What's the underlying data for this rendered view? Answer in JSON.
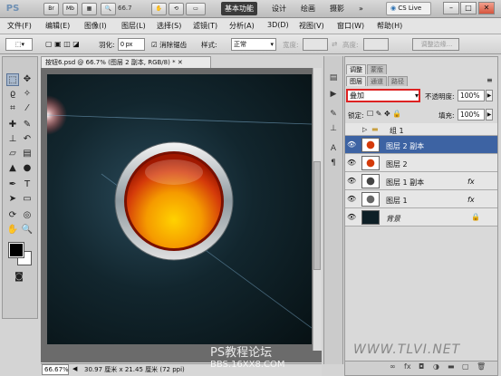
{
  "app": {
    "logo": "PS",
    "bridge": "Br",
    "minibridge": "Mb",
    "zoom": "66.7",
    "workspaces": [
      "基本功能",
      "设计",
      "绘画",
      "摄影"
    ],
    "more": "»",
    "cslive": "CS Live"
  },
  "menu": [
    "文件(F)",
    "编辑(E)",
    "图像(I)",
    "图层(L)",
    "选择(S)",
    "滤镜(T)",
    "分析(A)",
    "3D(D)",
    "视图(V)",
    "窗口(W)",
    "帮助(H)"
  ],
  "options": {
    "feather_label": "羽化:",
    "feather_value": "0 px",
    "antialias": "消除锯齿",
    "style_label": "样式:",
    "style_value": "正常",
    "width_label": "宽度:",
    "height_label": "高度:",
    "refine_edge": "调整边缘..."
  },
  "document": {
    "tab_title": "按钮6.psd @ 66.7% (图层 2 副本, RGB/8) *",
    "zoom": "66.67%",
    "info": "30.97 厘米 x 21.45 厘米 (72 ppi)"
  },
  "panel": {
    "tabs_top": [
      "调整",
      "蒙版"
    ],
    "tabs_layers": [
      "图层",
      "通道",
      "路径"
    ],
    "blend_mode": "叠加",
    "opacity_label": "不透明度:",
    "opacity_value": "100%",
    "lock_label": "锁定:",
    "fill_label": "填充:",
    "fill_value": "100%",
    "layers": [
      {
        "name": "组 1",
        "type": "group",
        "visible": false
      },
      {
        "name": "图层 2 副本",
        "type": "layer",
        "visible": true,
        "selected": true
      },
      {
        "name": "图层 2",
        "type": "layer",
        "visible": true
      },
      {
        "name": "图层 1 副本",
        "type": "layer",
        "visible": true,
        "fx": "fx"
      },
      {
        "name": "图层 1",
        "type": "layer",
        "visible": true,
        "fx": "fx"
      },
      {
        "name": "背景",
        "type": "background",
        "visible": true
      }
    ]
  },
  "watermark": {
    "line1": "PS教程论坛",
    "line2": "BBS.16XX8.COM",
    "site": "WWW.TLVI.NET"
  },
  "colors": {
    "selected_row": "#3d63a3",
    "blend_highlight": "#dd2222",
    "button_inner": "#f5a000",
    "button_outer": "#c02000"
  }
}
